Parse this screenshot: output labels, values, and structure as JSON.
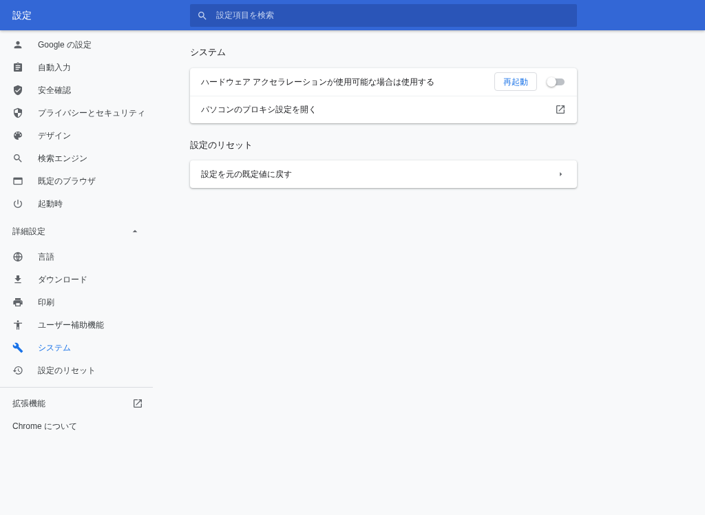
{
  "header": {
    "title": "設定",
    "search": {
      "placeholder": "設定項目を検索"
    }
  },
  "sidebar": {
    "items": [
      {
        "label": "Google の設定",
        "selected": false
      },
      {
        "label": "自動入力",
        "selected": false
      },
      {
        "label": "安全確認",
        "selected": false
      },
      {
        "label": "プライバシーとセキュリティ",
        "selected": false
      },
      {
        "label": "デザイン",
        "selected": false
      },
      {
        "label": "検索エンジン",
        "selected": false
      },
      {
        "label": "既定のブラウザ",
        "selected": false
      },
      {
        "label": "起動時",
        "selected": false
      }
    ],
    "advanced": {
      "label": "詳細設定",
      "expanded": true,
      "items": [
        {
          "label": "言語",
          "selected": false
        },
        {
          "label": "ダウンロード",
          "selected": false
        },
        {
          "label": "印刷",
          "selected": false
        },
        {
          "label": "ユーザー補助機能",
          "selected": false
        },
        {
          "label": "システム",
          "selected": true
        },
        {
          "label": "設定のリセット",
          "selected": false
        }
      ]
    },
    "footer_items": [
      {
        "label": "拡張機能",
        "kind": "external"
      },
      {
        "label": "Chrome について",
        "kind": "plain"
      }
    ]
  },
  "sections": [
    {
      "title": "システム",
      "rows": [
        {
          "kind": "toggle",
          "label": "ハードウェア アクセラレーションが使用可能な場合は使用する",
          "button": "再起動",
          "on": false
        },
        {
          "kind": "external",
          "label": "パソコンのプロキシ設定を開く"
        }
      ]
    },
    {
      "title": "設定のリセット",
      "rows": [
        {
          "kind": "arrow",
          "label": "設定を元の既定値に戻す"
        }
      ]
    }
  ]
}
